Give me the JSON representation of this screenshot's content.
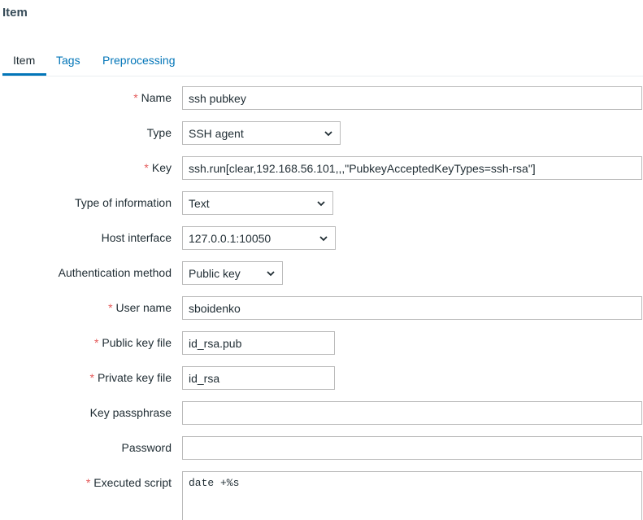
{
  "page": {
    "title": "Item"
  },
  "tabs": [
    {
      "label": "Item",
      "active": true
    },
    {
      "label": "Tags",
      "active": false
    },
    {
      "label": "Preprocessing",
      "active": false
    }
  ],
  "form": {
    "name": {
      "label": "Name",
      "required": "*",
      "value": "ssh pubkey"
    },
    "type": {
      "label": "Type",
      "value": "SSH agent"
    },
    "key": {
      "label": "Key",
      "required": "*",
      "value": "ssh.run[clear,192.168.56.101,,,\"PubkeyAcceptedKeyTypes=ssh-rsa\"]"
    },
    "type_of_information": {
      "label": "Type of information",
      "value": "Text"
    },
    "host_interface": {
      "label": "Host interface",
      "value": "127.0.0.1:10050"
    },
    "auth_method": {
      "label": "Authentication method",
      "value": "Public key"
    },
    "user_name": {
      "label": "User name",
      "required": "*",
      "value": "sboidenko"
    },
    "public_key_file": {
      "label": "Public key file",
      "required": "*",
      "value": "id_rsa.pub"
    },
    "private_key_file": {
      "label": "Private key file",
      "required": "*",
      "value": "id_rsa"
    },
    "key_passphrase": {
      "label": "Key passphrase",
      "value": ""
    },
    "password": {
      "label": "Password",
      "value": ""
    },
    "executed_script": {
      "label": "Executed script",
      "required": "*",
      "value": "date +%s"
    }
  },
  "icons": {
    "dropdown": "chevron-down-icon"
  },
  "colors": {
    "accent": "#0275b8",
    "required": "#e45959",
    "text": "#1f2c33",
    "border": "#bbbbbb"
  }
}
